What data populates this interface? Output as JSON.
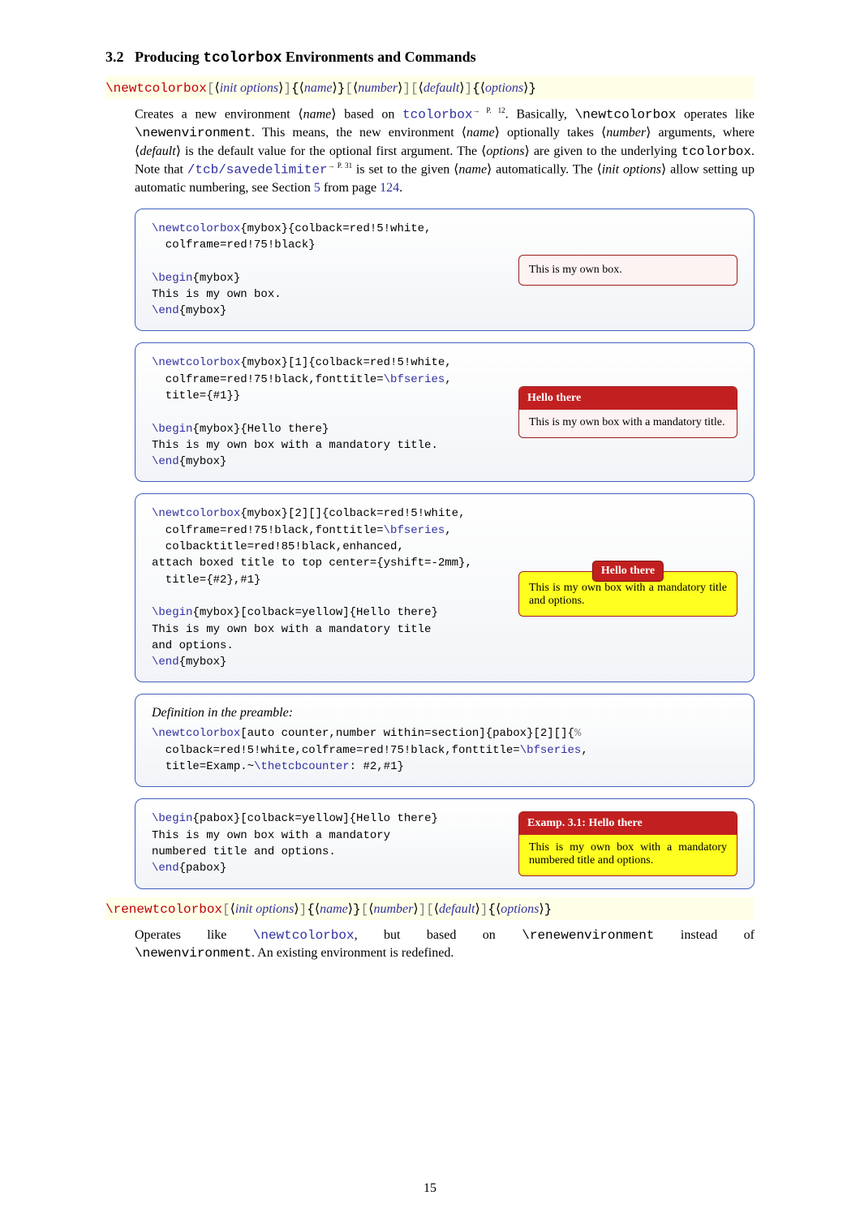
{
  "section": {
    "number": "3.2",
    "title": "Producing",
    "ttword": "tcolorbox",
    "tail": "Environments and Commands"
  },
  "cmd1": {
    "name": "\\newtcolorbox",
    "b1": "[",
    "p1": "init options",
    "b2": "]",
    "b3": "{",
    "p2": "name",
    "b4": "}",
    "b5": "[",
    "p3": "number",
    "b6": "]",
    "b7": "[",
    "p4": "default",
    "b8": "]",
    "b9": "{",
    "p5": "options",
    "b10": "}"
  },
  "para1": {
    "t1": "Creates a new environment ⟨",
    "i1": "name",
    "t2": "⟩ based on ",
    "link1": "tcolorbox",
    "sup1": "→ P. 12",
    "t3": ". Basically, ",
    "tt1": "\\newtcolorbox",
    "t4": " operates like ",
    "tt2": "\\newenvironment",
    "t5": ". This means, the new environment ⟨",
    "i2": "name",
    "t6": "⟩ optionally takes ⟨",
    "i3": "number",
    "t7": "⟩ arguments, where ⟨",
    "i4": "default",
    "t8": "⟩ is the default value for the optional first argument. The ⟨",
    "i5": "options",
    "t9": "⟩ are given to the underlying ",
    "tt3": "tcolorbox",
    "t10": ". Note that ",
    "link2": "/tcb/savedelimiter",
    "sup2": "→ P. 31",
    "t11": " is set to the given ⟨",
    "i6": "name",
    "t12": "⟩ automatically. The ⟨",
    "i7": "init options",
    "t13": "⟩ allow setting up automatic numbering, see Section ",
    "link3": "5",
    "t14": " from page ",
    "link4": "124",
    "t15": "."
  },
  "ex1": {
    "l1": "\\newtcolorbox",
    "l1b": "{mybox}{colback=red!5!white,",
    "l2": "  colframe=red!75!black}",
    "l3": "",
    "l4": "\\begin",
    "l4b": "{mybox}",
    "l5": "This is my own box.",
    "l6": "\\end",
    "l6b": "{mybox}",
    "outtext": "This is my own box."
  },
  "ex2": {
    "l1": "\\newtcolorbox",
    "l1b": "{mybox}[1]{colback=red!5!white,",
    "l2": "  colframe=red!75!black,fonttitle=",
    "l2b": "\\bfseries",
    "l2c": ",",
    "l3": "  title={#1}}",
    "l4": "",
    "l5": "\\begin",
    "l5b": "{mybox}{Hello there}",
    "l6": "This is my own box with a mandatory title.",
    "l7": "\\end",
    "l7b": "{mybox}",
    "title": "Hello there",
    "body": "This is my own box with a mandatory title."
  },
  "ex3": {
    "l1": "\\newtcolorbox",
    "l1b": "{mybox}[2][]{colback=red!5!white,",
    "l2": "  colframe=red!75!black,fonttitle=",
    "l2b": "\\bfseries",
    "l2c": ",",
    "l3": "  colbacktitle=red!85!black,enhanced,",
    "l4": "attach boxed title to top center={yshift=-2mm},",
    "l5": "  title={#2},#1}",
    "l6": "",
    "l7": "\\begin",
    "l7b": "{mybox}[colback=yellow]{Hello there}",
    "l8": "This is my own box with a mandatory title",
    "l9": "and options.",
    "l10": "\\end",
    "l10b": "{mybox}",
    "title2": "Hello there",
    "body2": "This is my own box with a mandatory title and options."
  },
  "ex4": {
    "preamble": "Definition in the preamble:",
    "l1": "\\newtcolorbox",
    "l1b": "[auto counter,number within=section]{pabox}[2][]{",
    "l1c": "%",
    "l2": "  colback=red!5!white,colframe=red!75!black,fonttitle=",
    "l2b": "\\bfseries",
    "l2c": ",",
    "l3": "  title=Examp.~",
    "l3b": "\\thetcbcounter",
    "l3c": ": #2,#1}"
  },
  "ex5": {
    "l1": "\\begin",
    "l1b": "{pabox}[colback=yellow]{Hello there}",
    "l2": "This is my own box with a mandatory",
    "l3": "numbered title and options.",
    "l4": "\\end",
    "l4b": "{pabox}",
    "title3": "Examp. 3.1: Hello there",
    "body3": "This is my own box with a mandatory numbered title and options."
  },
  "cmd2": {
    "name": "\\renewtcolorbox"
  },
  "para2": {
    "t1": "Operates like ",
    "link1": "\\newtcolorbox",
    "t2": ", but based on ",
    "tt1": "\\renewenvironment",
    "t3": " instead of ",
    "tt2": "\\newenvironment",
    "t4": ". An existing environment is redefined."
  },
  "pagenum": "15"
}
